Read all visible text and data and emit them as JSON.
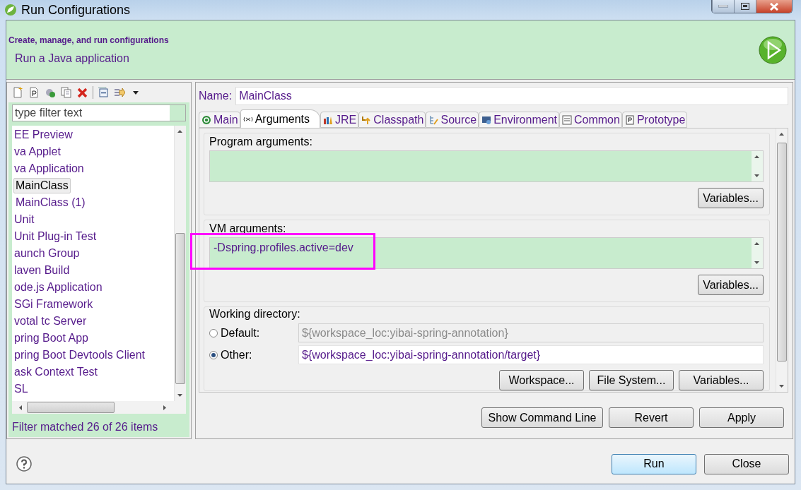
{
  "window": {
    "title": "Run Configurations"
  },
  "header": {
    "title": "Create, manage, and run configurations",
    "subtitle": "Run a Java application"
  },
  "filter": {
    "placeholder": "type filter text"
  },
  "tree": [
    {
      "label": "EE Preview",
      "selected": false
    },
    {
      "label": "va Applet",
      "selected": false
    },
    {
      "label": "va Application",
      "selected": false,
      "children": [
        {
          "label": "MainClass",
          "selected": true
        },
        {
          "label": "MainClass (1)",
          "selected": false
        }
      ]
    },
    {
      "label": "Unit",
      "selected": false
    },
    {
      "label": "Unit Plug-in Test",
      "selected": false
    },
    {
      "label": "aunch Group",
      "selected": false
    },
    {
      "label": "laven Build",
      "selected": false
    },
    {
      "label": "ode.js Application",
      "selected": false
    },
    {
      "label": "SGi Framework",
      "selected": false
    },
    {
      "label": "votal tc Server",
      "selected": false
    },
    {
      "label": "pring Boot App",
      "selected": false
    },
    {
      "label": "pring Boot Devtools Client",
      "selected": false
    },
    {
      "label": "ask Context Test",
      "selected": false
    },
    {
      "label": "SL",
      "selected": false
    }
  ],
  "filter_status": "Filter matched 26 of 26 items",
  "name": {
    "label": "Name:",
    "value": "MainClass"
  },
  "tabs": [
    {
      "label": "Main",
      "selected": false
    },
    {
      "label": "Arguments",
      "selected": true
    },
    {
      "label": "JRE",
      "selected": false
    },
    {
      "label": "Classpath",
      "selected": false
    },
    {
      "label": "Source",
      "selected": false
    },
    {
      "label": "Environment",
      "selected": false
    },
    {
      "label": "Common",
      "selected": false
    },
    {
      "label": "Prototype",
      "selected": false
    }
  ],
  "program_arguments": {
    "label": "Program arguments:",
    "button": "Variables..."
  },
  "vm_arguments": {
    "label": "VM arguments:",
    "value": "-Dspring.profiles.active=dev",
    "button": "Variables..."
  },
  "working_directory": {
    "label": "Working directory:",
    "options": [
      {
        "label": "Default:",
        "selected": false,
        "value": "${workspace_loc:yibai-spring-annotation}",
        "disabled": true
      },
      {
        "label": "Other:",
        "selected": true,
        "value": "${workspace_loc:yibai-spring-annotation/target}",
        "disabled": false
      }
    ],
    "buttons": [
      "Workspace...",
      "File System...",
      "Variables..."
    ]
  },
  "actions": [
    "Show Command Line",
    "Revert",
    "Apply"
  ],
  "dialog_buttons": [
    {
      "label": "Run",
      "default": true
    },
    {
      "label": "Close",
      "default": false
    }
  ]
}
